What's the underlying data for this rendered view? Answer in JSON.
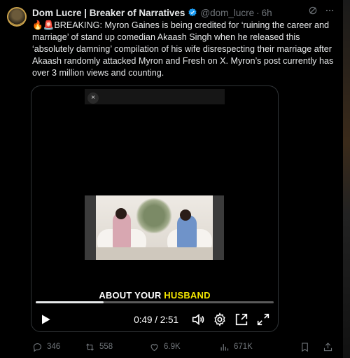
{
  "tweet": {
    "author_name": "Dom Lucre | Breaker of Narratives",
    "handle": "@dom_lucre",
    "dot": "·",
    "time": "6h",
    "text": "🔥🚨BREAKING: Myron Gaines is being credited for ‘ruining the career and marriage’ of stand up comedian Akaash Singh when he released this ‘absolutely damning’ compilation of his wife disrespecting their marriage after Akaash randomly attacked Myron and Fresh on X. Myron’s post currently has over 3 million views and counting."
  },
  "video": {
    "close_glyph": "×",
    "caption_prefix": "ABOUT YOUR ",
    "caption_highlight": "HUSBAND",
    "timecode": "0:49 / 2:51",
    "progress": 0.286
  },
  "actions": {
    "replies": "346",
    "reposts": "558",
    "likes": "6.9K",
    "views": "671K"
  },
  "colors": {
    "accent_verified": "#1d9bf0",
    "muted": "#71767b",
    "caption_highlight": "#f3e600"
  }
}
